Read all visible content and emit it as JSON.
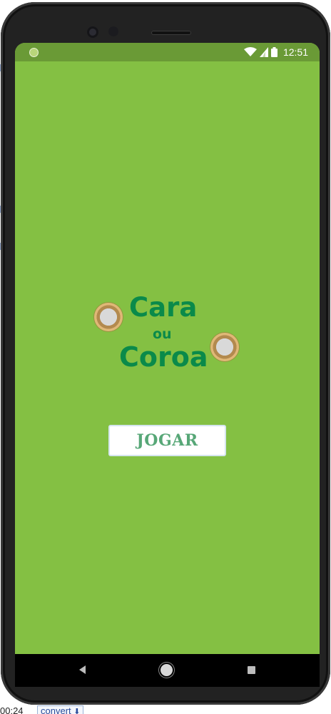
{
  "status_bar": {
    "time": "12:51"
  },
  "title": {
    "line1": "Cara",
    "line2": "ou",
    "line3": "Coroa"
  },
  "play_button": {
    "label": "JOGAR"
  },
  "footer": {
    "timer": "00:24",
    "convert_label": "convert",
    "download_glyph": "⬇"
  },
  "colors": {
    "screen_bg": "#84c043",
    "status_bg": "#6a9a36",
    "title": "#0a8a4a",
    "button_text": "#57a777"
  },
  "icons": [
    "wifi-icon",
    "signal-icon",
    "battery-icon",
    "coin-icon",
    "back-icon",
    "home-icon",
    "recent-apps-icon"
  ]
}
